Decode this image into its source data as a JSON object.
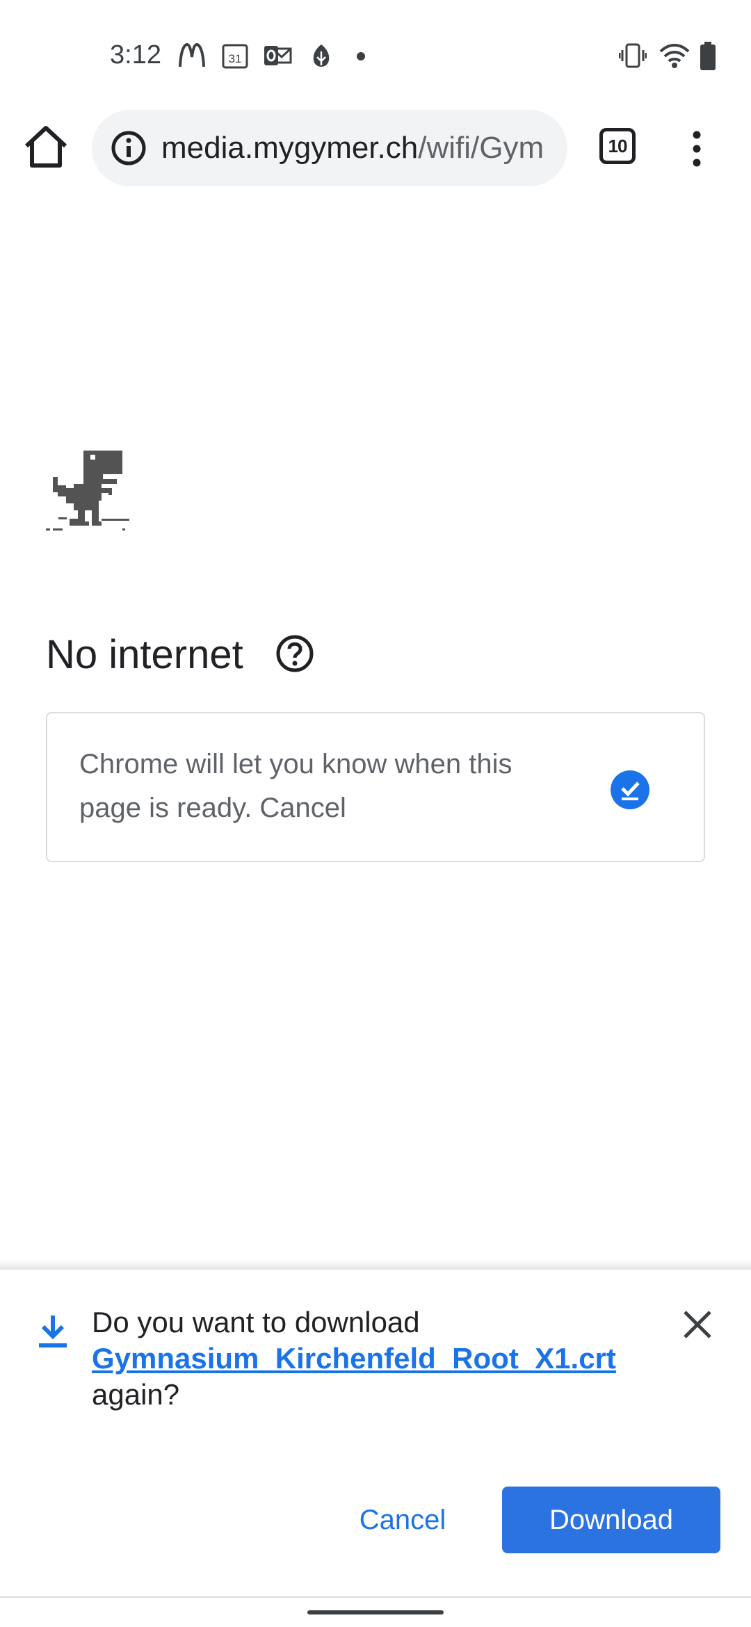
{
  "status_bar": {
    "time": "3:12",
    "left_icons": [
      "mcdonalds-icon",
      "calendar-icon",
      "outlook-icon",
      "leaf-app-icon",
      "dot-icon"
    ],
    "calendar_day": "31",
    "right_icons": [
      "vibrate-icon",
      "wifi-icon",
      "battery-icon"
    ]
  },
  "toolbar": {
    "url_host": "media.mygymer.ch",
    "url_path": "/wifi/Gym",
    "tab_count": "10"
  },
  "page": {
    "title": "No internet",
    "notify_text": "Chrome will let you know when this page is ready. Cancel"
  },
  "download_sheet": {
    "question_prefix": "Do you want to download",
    "file_name": "Gymnasium_Kirchenfeld_Root_X1.crt",
    "question_suffix": "again?",
    "cancel_label": "Cancel",
    "download_label": "Download"
  },
  "colors": {
    "accent": "#1a73e8",
    "button": "#2b73e0",
    "dino": "#535353"
  }
}
